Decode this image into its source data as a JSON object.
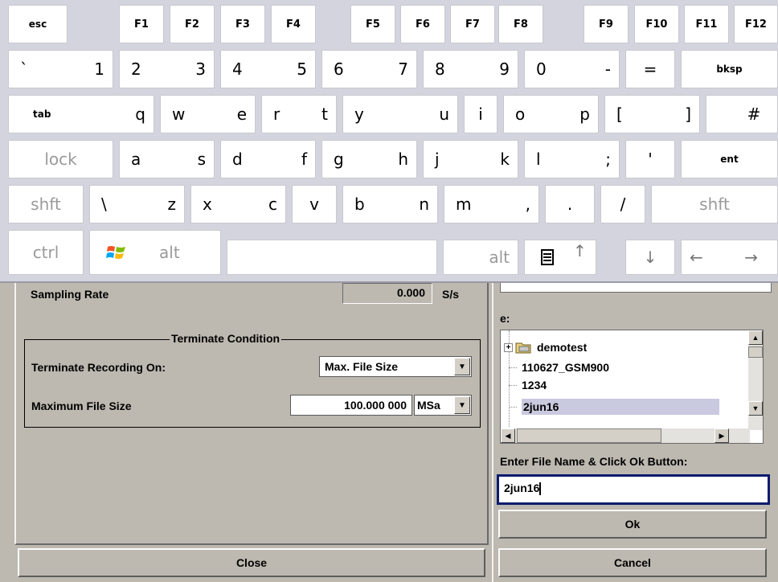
{
  "keyboard": {
    "function_row": [
      "esc",
      "F1",
      "F2",
      "F3",
      "F4",
      "F5",
      "F6",
      "F7",
      "F8",
      "F9",
      "F10",
      "F11",
      "F12"
    ],
    "number_row": [
      "`",
      "1",
      "2",
      "3",
      "4",
      "5",
      "6",
      "7",
      "8",
      "9",
      "0",
      "-",
      "=",
      "bksp"
    ],
    "q_row": [
      "tab",
      "q",
      "w",
      "e",
      "r",
      "t",
      "y",
      "u",
      "i",
      "o",
      "p",
      "[",
      "]",
      "#"
    ],
    "a_row": [
      "lock",
      "a",
      "s",
      "d",
      "f",
      "g",
      "h",
      "j",
      "k",
      "l",
      ";",
      "'",
      "ent"
    ],
    "z_row": [
      "shft",
      "\\",
      "z",
      "x",
      "c",
      "v",
      "b",
      "n",
      "m",
      ",",
      ".",
      "/",
      "shft"
    ],
    "bottom_row": {
      "ctrl": "ctrl",
      "alt_left": "alt",
      "alt_right": "alt",
      "up": "↑",
      "down": "↓",
      "left": "←",
      "right": "→"
    }
  },
  "recorder": {
    "sampling_rate_label": "Sampling Rate",
    "sampling_rate_value": "0.000",
    "sampling_rate_unit": "S/s",
    "group_title": "Terminate Condition",
    "terminate_label": "Terminate Recording On:",
    "terminate_value": "Max. File Size",
    "max_size_label": "Maximum File Size",
    "max_size_value": "100.000 000",
    "max_size_unit": "MSa",
    "close_label": "Close"
  },
  "file_dialog": {
    "drive_label": "e:",
    "tree_items": [
      "demotest",
      "110627_GSM900",
      "1234",
      "2jun16"
    ],
    "selected_item": "2jun16",
    "prompt": "Enter File Name & Click Ok Button:",
    "file_name": "2jun16",
    "ok_label": "Ok",
    "cancel_label": "Cancel",
    "selection_color": "#c9c9e0",
    "input_border_color": "#0a1c6e"
  }
}
